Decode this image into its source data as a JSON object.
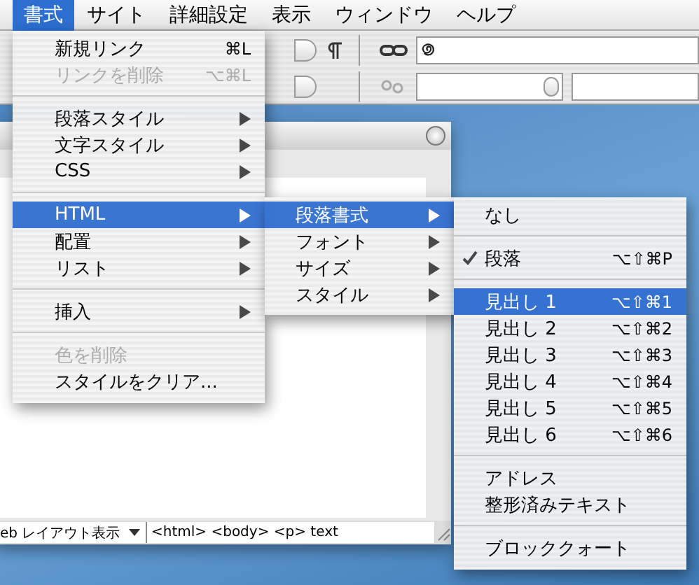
{
  "menubar": [
    {
      "label": "書式",
      "selected": true
    },
    {
      "label": "サイト",
      "selected": false
    },
    {
      "label": "詳細設定",
      "selected": false
    },
    {
      "label": "表示",
      "selected": false
    },
    {
      "label": "ウィンドウ",
      "selected": false
    },
    {
      "label": "ヘルプ",
      "selected": false
    }
  ],
  "document_window": {
    "view_select": "eb レイアウト表示",
    "tag_path": "<html> <body> <p> text"
  },
  "menus": [
    {
      "items": [
        {
          "kind": "item",
          "label": "新規リンク",
          "shortcut": "⌘L",
          "disabled": false,
          "selected": false,
          "checked": false,
          "submenu": false
        },
        {
          "kind": "item",
          "label": "リンクを削除",
          "shortcut": "⌥⌘L",
          "disabled": true,
          "selected": false,
          "checked": false,
          "submenu": false
        },
        {
          "kind": "separator"
        },
        {
          "kind": "item",
          "label": "段落スタイル",
          "disabled": false,
          "selected": false,
          "checked": false,
          "submenu": true
        },
        {
          "kind": "item",
          "label": "文字スタイル",
          "disabled": false,
          "selected": false,
          "checked": false,
          "submenu": true
        },
        {
          "kind": "item",
          "label": "CSS",
          "disabled": false,
          "selected": false,
          "checked": false,
          "submenu": true
        },
        {
          "kind": "separator"
        },
        {
          "kind": "item",
          "label": "HTML",
          "disabled": false,
          "selected": true,
          "checked": false,
          "submenu": true
        },
        {
          "kind": "item",
          "label": "配置",
          "disabled": false,
          "selected": false,
          "checked": false,
          "submenu": true
        },
        {
          "kind": "item",
          "label": "リスト",
          "disabled": false,
          "selected": false,
          "checked": false,
          "submenu": true
        },
        {
          "kind": "separator"
        },
        {
          "kind": "item",
          "label": "挿入",
          "disabled": false,
          "selected": false,
          "checked": false,
          "submenu": true
        },
        {
          "kind": "separator"
        },
        {
          "kind": "item",
          "label": "色を削除",
          "disabled": true,
          "selected": false,
          "checked": false,
          "submenu": false
        },
        {
          "kind": "item",
          "label": "スタイルをクリア...",
          "disabled": false,
          "selected": false,
          "checked": false,
          "submenu": false
        }
      ]
    },
    {
      "items": [
        {
          "kind": "item",
          "label": "段落書式",
          "disabled": false,
          "selected": true,
          "checked": false,
          "submenu": true
        },
        {
          "kind": "item",
          "label": "フォント",
          "disabled": false,
          "selected": false,
          "checked": false,
          "submenu": true
        },
        {
          "kind": "item",
          "label": "サイズ",
          "disabled": false,
          "selected": false,
          "checked": false,
          "submenu": true
        },
        {
          "kind": "item",
          "label": "スタイル",
          "disabled": false,
          "selected": false,
          "checked": false,
          "submenu": true
        }
      ]
    },
    {
      "items": [
        {
          "kind": "item",
          "label": "なし",
          "disabled": false,
          "selected": false,
          "checked": false,
          "submenu": false
        },
        {
          "kind": "separator"
        },
        {
          "kind": "item",
          "label": "段落",
          "shortcut": "⌥⇧⌘P",
          "disabled": false,
          "selected": false,
          "checked": true,
          "submenu": false
        },
        {
          "kind": "separator"
        },
        {
          "kind": "item",
          "label": "見出し 1",
          "shortcut": "⌥⇧⌘1",
          "disabled": false,
          "selected": true,
          "checked": false,
          "submenu": false
        },
        {
          "kind": "item",
          "label": "見出し 2",
          "shortcut": "⌥⇧⌘2",
          "disabled": false,
          "selected": false,
          "checked": false,
          "submenu": false
        },
        {
          "kind": "item",
          "label": "見出し 3",
          "shortcut": "⌥⇧⌘3",
          "disabled": false,
          "selected": false,
          "checked": false,
          "submenu": false
        },
        {
          "kind": "item",
          "label": "見出し 4",
          "shortcut": "⌥⇧⌘4",
          "disabled": false,
          "selected": false,
          "checked": false,
          "submenu": false
        },
        {
          "kind": "item",
          "label": "見出し 5",
          "shortcut": "⌥⇧⌘5",
          "disabled": false,
          "selected": false,
          "checked": false,
          "submenu": false
        },
        {
          "kind": "item",
          "label": "見出し 6",
          "shortcut": "⌥⇧⌘6",
          "disabled": false,
          "selected": false,
          "checked": false,
          "submenu": false
        },
        {
          "kind": "separator"
        },
        {
          "kind": "item",
          "label": "アドレス",
          "disabled": false,
          "selected": false,
          "checked": false,
          "submenu": false
        },
        {
          "kind": "item",
          "label": "整形済みテキスト",
          "disabled": false,
          "selected": false,
          "checked": false,
          "submenu": false
        },
        {
          "kind": "separator"
        },
        {
          "kind": "item",
          "label": "ブロッククォート",
          "disabled": false,
          "selected": false,
          "checked": false,
          "submenu": false
        }
      ]
    }
  ]
}
